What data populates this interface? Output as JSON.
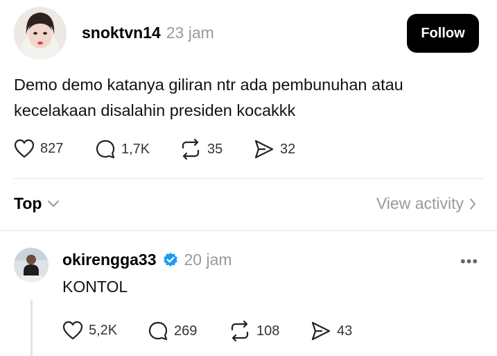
{
  "post": {
    "username": "snoktvn14",
    "time": "23 jam",
    "follow_label": "Follow",
    "text_line1": "Demo demo katanya giliran ntr ada pembunuhan atau",
    "text_line2": "kecelakaan disalahin presiden kocakkk",
    "likes": "827",
    "comments": "1,7K",
    "reposts": "35",
    "shares": "32"
  },
  "sort": {
    "label": "Top",
    "view_activity": "View activity"
  },
  "reply": {
    "username": "okirengga33",
    "time": "20 jam",
    "text": "KONTOL",
    "likes": "5,2K",
    "comments": "269",
    "reposts": "108",
    "shares": "43"
  },
  "colors": {
    "verified": "#1d9bf0",
    "muted": "#9a9a9a"
  }
}
